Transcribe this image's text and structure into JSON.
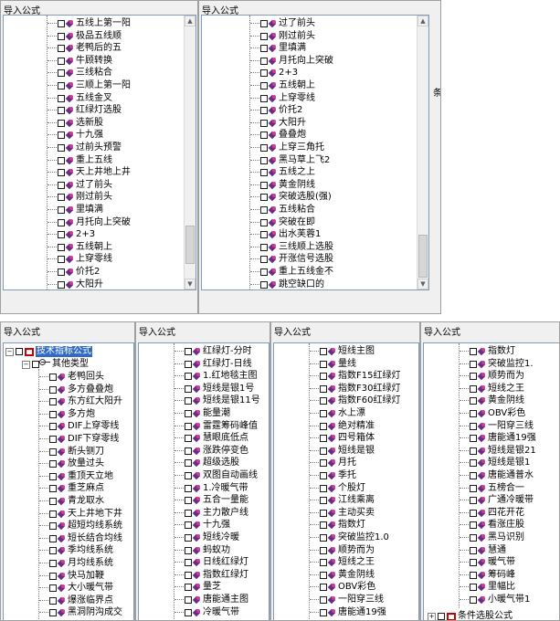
{
  "panels": [
    {
      "title": "导入公式",
      "items": [
        "五线上第一阳",
        "极品五线顺",
        "老鸭后的五",
        "牛顾转换",
        "三线粘合",
        "三顺上第一阳",
        "五线金叉",
        "红绿灯选股",
        "选新股",
        "十九强",
        "过前头预警",
        "重上五线",
        "天上井地上井",
        "过了前头",
        "刚过前头",
        "里填满",
        "月托向上突破",
        "2+3",
        "五线朝上",
        "上穿零线",
        "价托2",
        "大阳升"
      ]
    },
    {
      "title": "导入公式",
      "items": [
        "过了前头",
        "刚过前头",
        "里填满",
        "月托向上突破",
        "2+3",
        "五线朝上",
        "上穿零线",
        "价托2",
        "大阳升",
        "叠叠炮",
        "上穿三角托",
        "黑马草上飞2",
        "五线之上",
        "黄金阴线",
        "突破选股(强)",
        "五线粘合",
        "突破在即",
        "出水芙蓉1",
        "三线顺上选股",
        "开涨信号选股",
        "重上五线金不",
        "跳空缺口的"
      ]
    },
    {
      "title": "导入公式",
      "root": "技术指标公式",
      "group": "其他类型",
      "items": [
        "老鸭回头",
        "多方叠叠炮",
        "东方红大阳升",
        "多方炮",
        "DIF上穿零线",
        "DIF下穿零线",
        "断头铡刀",
        "放量过头",
        "重顶天立地",
        "重芝麻点",
        "青龙取水",
        "天上井地下井",
        "超短均线系统",
        "短长结合均线",
        "季均线系统",
        "月均线系统",
        "快马加鞭",
        "大小暖气带",
        "爆涨临界点",
        "黑洞阴沟成交"
      ]
    },
    {
      "title": "导入公式",
      "items": [
        "红绿灯-分时",
        "红绿灯-日线",
        "1.红地毯主图",
        "短线是银1号",
        "短线是银11号",
        "能量潮",
        "雷霆筹码峰值",
        "慧眼底低点",
        "涨跌停变色",
        "超级选股",
        "双图自动画线",
        "1.冷暖气带",
        "五合一量能",
        "主力散户线",
        "十九强",
        "短线冷暖",
        "蚂蚁功",
        "日线红绿灯",
        "指数红绿灯",
        "量芝",
        "唐能通主图",
        "冷暖气带"
      ]
    },
    {
      "title": "导入公式",
      "items": [
        "短线主图",
        "量线",
        "指数F15红绿灯",
        "指数F30红绿灯",
        "指数F60红绿灯",
        "水上漂",
        "绝对精准",
        "四号箱体",
        "短线是银",
        "月托",
        "季托",
        "个股灯",
        "江线乘离",
        "主动买卖",
        "指数灯",
        "突破监控1.0",
        "顺势而为",
        "短线之王",
        "黄金阴线",
        "OBV彩色",
        "一阳穿三线",
        "唐能通19强"
      ]
    },
    {
      "title": "导入公式",
      "items": [
        "指数灯",
        "突破监控1.",
        "顺势而为",
        "短线之王",
        "黄金阴线",
        "OBV彩色",
        "一阳穿三线",
        "唐能通19强",
        "短线是银21",
        "短线是银1",
        "唐能通普水",
        "五榜合一",
        "广通冷暖带",
        "四花开花",
        "看涨庄股",
        "黑马识别",
        "慧通",
        "暖气带",
        "筹码峰",
        "里幅比",
        "小暖气带1"
      ],
      "footer": "条件选股公式"
    }
  ],
  "stray_text": "条"
}
